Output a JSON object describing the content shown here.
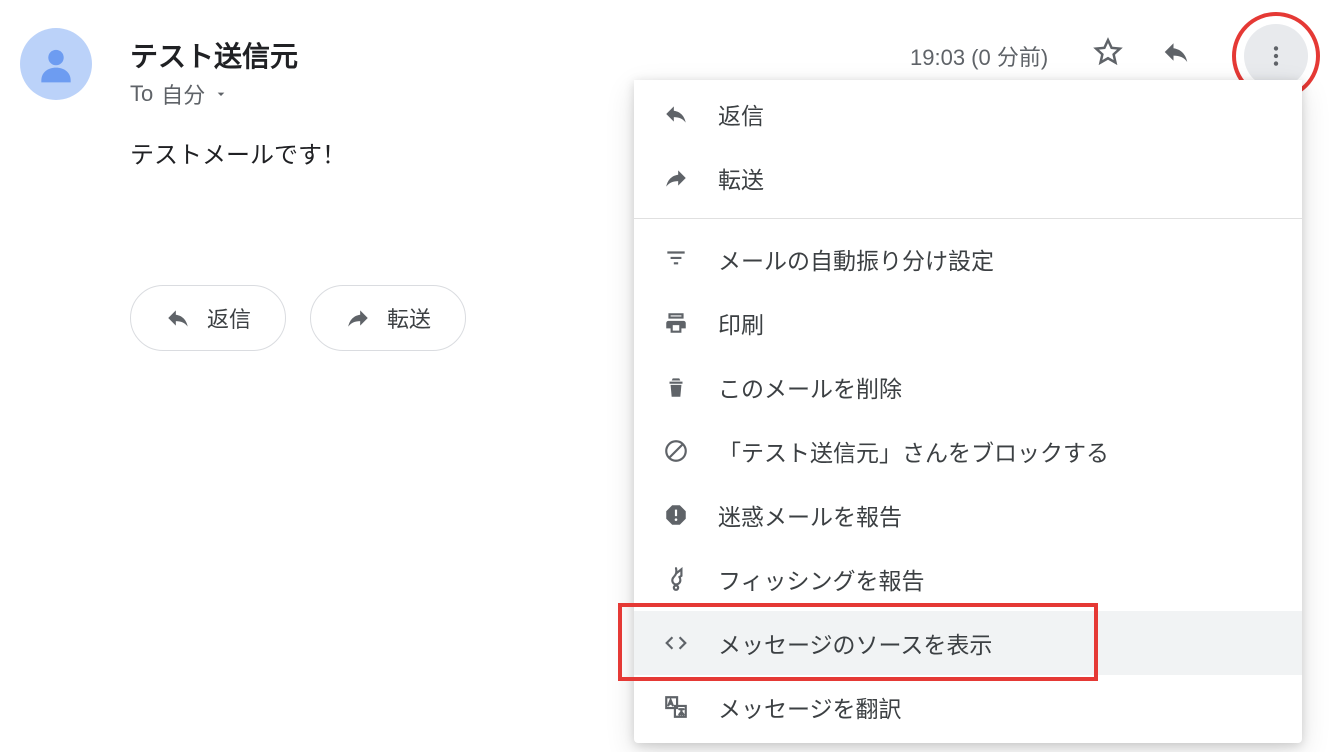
{
  "header": {
    "sender_name": "テスト送信元",
    "recipient_prefix": "To",
    "recipient_label": "自分",
    "timestamp": "19:03 (0 分前)"
  },
  "body": {
    "text": "テストメールです！"
  },
  "actions": {
    "reply_label": "返信",
    "forward_label": "転送"
  },
  "menu": {
    "items": [
      {
        "icon": "reply",
        "label": "返信"
      },
      {
        "icon": "forward",
        "label": "転送"
      },
      {
        "divider": true
      },
      {
        "icon": "filter",
        "label": "メールの自動振り分け設定"
      },
      {
        "icon": "print",
        "label": "印刷"
      },
      {
        "icon": "delete",
        "label": "このメールを削除"
      },
      {
        "icon": "block",
        "label": "「テスト送信元」さんをブロックする"
      },
      {
        "icon": "spam",
        "label": "迷惑メールを報告"
      },
      {
        "icon": "phishing",
        "label": "フィッシングを報告"
      },
      {
        "icon": "code",
        "label": "メッセージのソースを表示",
        "hover": true,
        "highlighted": true
      },
      {
        "icon": "translate",
        "label": "メッセージを翻訳"
      }
    ]
  },
  "annotations": {
    "circle_more_button": true
  }
}
